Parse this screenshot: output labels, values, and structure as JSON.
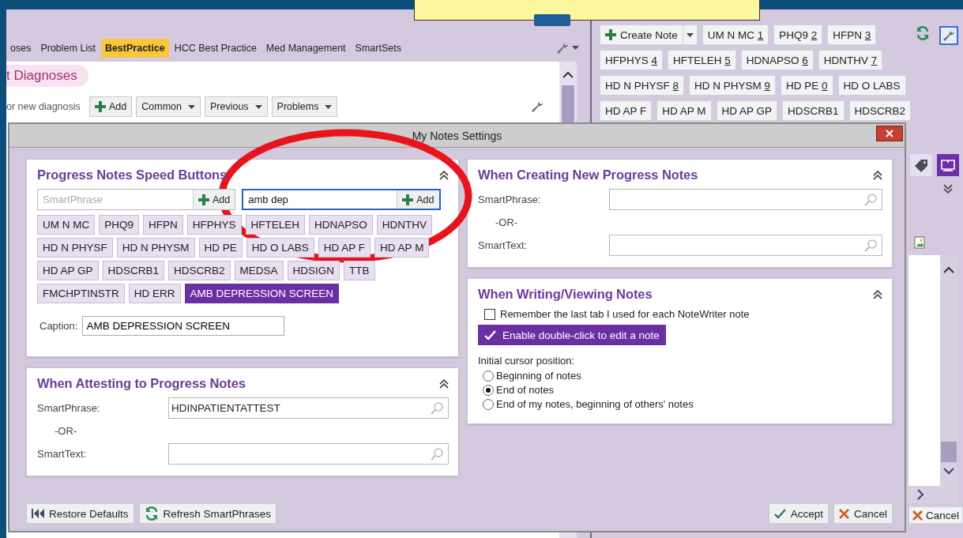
{
  "app": {
    "tabs": [
      {
        "label": "oses",
        "selected": false
      },
      {
        "label": "Problem List",
        "selected": false
      },
      {
        "label": "BestPractice",
        "selected": true
      },
      {
        "label": "HCC Best Practice",
        "selected": false
      },
      {
        "label": "Med Management",
        "selected": false
      },
      {
        "label": "SmartSets",
        "selected": false
      }
    ],
    "diagnoses": {
      "title": "t Diagnoses",
      "search_placeholder": "or new diagnosis",
      "add": "Add",
      "menus": [
        "Common",
        "Previous",
        "Problems"
      ]
    },
    "notes_toolbar": {
      "create": "Create Note",
      "speed_buttons": [
        {
          "label": "UM N MC",
          "key": "1"
        },
        {
          "label": "PHQ9",
          "key": "2"
        },
        {
          "label": "HFPN",
          "key": "3"
        },
        {
          "label": "HFPHYS",
          "key": "4"
        },
        {
          "label": "HFTELEH",
          "key": "5"
        },
        {
          "label": "HDNAPSO",
          "key": "6"
        },
        {
          "label": "HDNTHV",
          "key": "7"
        },
        {
          "label": "HD N PHYSF",
          "key": "8"
        },
        {
          "label": "HD N PHYSM",
          "key": "9"
        },
        {
          "label": "HD PE",
          "key": "0"
        },
        {
          "label": "HD O LABS"
        },
        {
          "label": "HD AP F"
        },
        {
          "label": "HD AP M"
        },
        {
          "label": "HD AP GP"
        },
        {
          "label": "HDSCRB1"
        },
        {
          "label": "HDSCRB2"
        }
      ]
    },
    "side_cancel": "Cancel"
  },
  "dialog": {
    "title": "My Notes Settings",
    "speed_panel": {
      "title": "Progress Notes Speed Buttons",
      "phrase_placeholder": "SmartPhrase",
      "add_left": "Add",
      "search_value": "amb dep",
      "add_right": "Add",
      "buttons": [
        {
          "label": "UM N MC",
          "selected": false
        },
        {
          "label": "PHQ9",
          "selected": false
        },
        {
          "label": "HFPN",
          "selected": false
        },
        {
          "label": "HFPHYS",
          "selected": false
        },
        {
          "label": "HFTELEH",
          "selected": false
        },
        {
          "label": "HDNAPSO",
          "selected": false
        },
        {
          "label": "HDNTHV",
          "selected": false
        },
        {
          "label": "HD N PHYSF",
          "selected": false
        },
        {
          "label": "HD N PHYSM",
          "selected": false
        },
        {
          "label": "HD PE",
          "selected": false
        },
        {
          "label": "HD O LABS",
          "selected": false
        },
        {
          "label": "HD AP F",
          "selected": false
        },
        {
          "label": "HD AP M",
          "selected": false
        },
        {
          "label": "HD AP GP",
          "selected": false
        },
        {
          "label": "HDSCRB1",
          "selected": false
        },
        {
          "label": "HDSCRB2",
          "selected": false
        },
        {
          "label": "MEDSA",
          "selected": false
        },
        {
          "label": "HDSIGN",
          "selected": false
        },
        {
          "label": "TTB",
          "selected": false
        },
        {
          "label": "FMCHPTINSTR",
          "selected": false
        },
        {
          "label": "HD ERR",
          "selected": false
        },
        {
          "label": "AMB DEPRESSION SCREEN",
          "selected": true
        }
      ],
      "caption_label": "Caption:",
      "caption_value": "AMB DEPRESSION SCREEN"
    },
    "attest_panel": {
      "title": "When Attesting to Progress Notes",
      "fields": [
        {
          "label": "SmartPhrase:",
          "value": "HDINPATIENTATTEST"
        },
        {
          "label": "SmartText:"
        }
      ],
      "or": "-OR-"
    },
    "create_panel": {
      "title": "When Creating New Progress Notes",
      "fields": [
        {
          "label": "SmartPhrase:"
        },
        {
          "label": "SmartText:"
        }
      ],
      "or": "-OR-"
    },
    "view_panel": {
      "title": "When Writing/Viewing Notes",
      "checkbox": {
        "label": "Remember the last tab I used for each NoteWriter note",
        "checked": false
      },
      "toggle": {
        "label": "Enable double-click to edit a note",
        "on": true
      },
      "cursor_label": "Initial cursor position:",
      "options": [
        {
          "label": "Beginning of notes",
          "selected": false
        },
        {
          "label": "End of notes",
          "selected": true
        },
        {
          "label": "End of my notes, beginning of others' notes",
          "selected": false
        }
      ]
    },
    "footer": {
      "restore": "Restore Defaults",
      "refresh": "Refresh SmartPhrases",
      "accept": "Accept",
      "cancel": "Cancel"
    }
  },
  "annotation": {
    "kind": "ellipse"
  }
}
